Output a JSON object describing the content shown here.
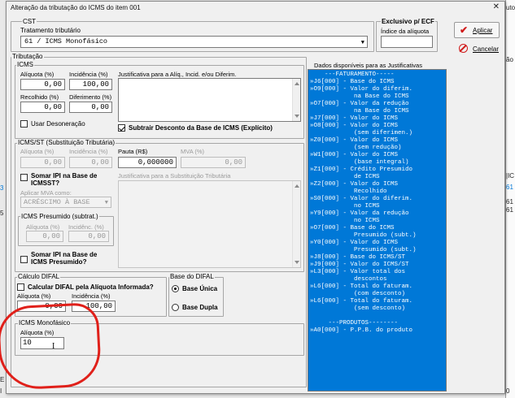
{
  "window": {
    "title": "Alteração da tributação do ICMS do item 001"
  },
  "bg": {
    "right_top": "utos",
    "right_label": "ão",
    "ic": "|IC",
    "v1": "61",
    "v2": "61",
    "v3": "61",
    "v4": "61",
    "left_e": "E",
    "left_i": "I",
    "bottom_0": "0",
    "left_3": "3",
    "left_5": "5"
  },
  "cst": {
    "group": "CST",
    "label": "Tratamento tributário",
    "value": "61 / ICMS Monofásico"
  },
  "ecf": {
    "group": "Exclusivo p/ ECF",
    "label": "Índice da alíquota",
    "value": ""
  },
  "buttons": {
    "apply": "Aplicar",
    "cancel": "Cancelar"
  },
  "tributacao": {
    "group": "Tributação"
  },
  "icms": {
    "group": "ICMS",
    "aliquota_label": "Alíquota (%)",
    "aliquota": "0,00",
    "incidencia_label": "Incidência (%)",
    "incidencia": "100,00",
    "justificativa_label": "Justificativa para a Alíq., Incid. e/ou Diferim.",
    "recolhido_label": "Recolhido (%)",
    "recolhido": "0,00",
    "diferimento_label": "Diferimento (%)",
    "diferimento": "0,00",
    "desoneracao_label": "Usar Desoneração",
    "subtrair_label": "Subtrair Desconto da Base de ICMS (Explícito)"
  },
  "icmsst": {
    "group": "ICMS/ST (Substituição Tributária)",
    "aliquota_label": "Alíquota (%)",
    "aliquota": "0,00",
    "incidencia_label": "Incidência (%)",
    "incidencia": "0,00",
    "pauta_label": "Pauta (R$)",
    "pauta": "0,000000",
    "mva_label": "MVA (%)",
    "mva": "0,00",
    "somar_ipi_label": "Somar IPI na Base de ICMSST?",
    "justificativa_label": "Justificativa para a Substituição Tributária",
    "aplicar_mva_label": "Aplicar MVA como:",
    "aplicar_mva_value": "ACRÉSCIMO À BASE"
  },
  "presumido": {
    "group": "ICMS Presumido (subtrat.)",
    "aliquota_label": "Alíquota (%)",
    "aliquota": "0,00",
    "incidencia_label": "Incidênc. (%)",
    "incidencia": "0,00",
    "somar_ipi_label": "Somar IPI na Base de ICMS Presumido?"
  },
  "difal": {
    "group": "Cálculo DIFAL",
    "calcular_label": "Calcular DIFAL pela Alíquota Informada?",
    "aliquota_label": "Alíquota (%)",
    "aliquota": "0,00",
    "incidencia_label": "Incidência (%)",
    "incidencia": "100,00"
  },
  "base_difal": {
    "group": "Base do DIFAL",
    "unica": "Base Única",
    "dupla": "Base Dupla"
  },
  "monofasico": {
    "group": "ICMS Monofásico",
    "aliquota_label": "Alíquota (%)",
    "aliquota": "10",
    "cursor": "I"
  },
  "dados": {
    "label": "Dados disponíveis para as Justificativas",
    "lines": [
      "    ---FATURAMENTO-----",
      "»J6[000] - Base do ICMS",
      "»O9[000] - Valor do diferim.",
      "            na Base do ICMS",
      "»O7[000] - Valor da redução",
      "            na Base do ICMS",
      "»J7[000] - Valor do ICMS",
      "»O8[000] - Valor do ICMS",
      "            (sem diferimen.)",
      "»Z0[000] - Valor do ICMS",
      "            (sem redução)",
      "»W1[000] - Valor do ICMS",
      "            (base integral)",
      "»Z1[000] - Crédito Presumido",
      "            de ICMS",
      "»Z2[000] - Valor do ICMS",
      "            Recolhido",
      "»S0[000] - Valor do diferim.",
      "            no ICMS",
      "»Y9[000] - Valor da redução",
      "            no ICMS",
      "»O7[000] - Base do ICMS",
      "            Presumido (subt.)",
      "»Y0[000] - Valor do ICMS",
      "            Presumido (subt.)",
      "»J8[000] - Base do ICMS/ST",
      "»J9[000] - Valor do ICMS/ST",
      "»L3[000] - Valor total dos",
      "            descontos",
      "»L6[000] - Total do faturam.",
      "            (com desconto)",
      "»L6[000] - Total do faturam.",
      "            (sem desconto)",
      "",
      "     ---PRODUTOS--------",
      "»A0[000] - P.P.B. do produto"
    ]
  }
}
